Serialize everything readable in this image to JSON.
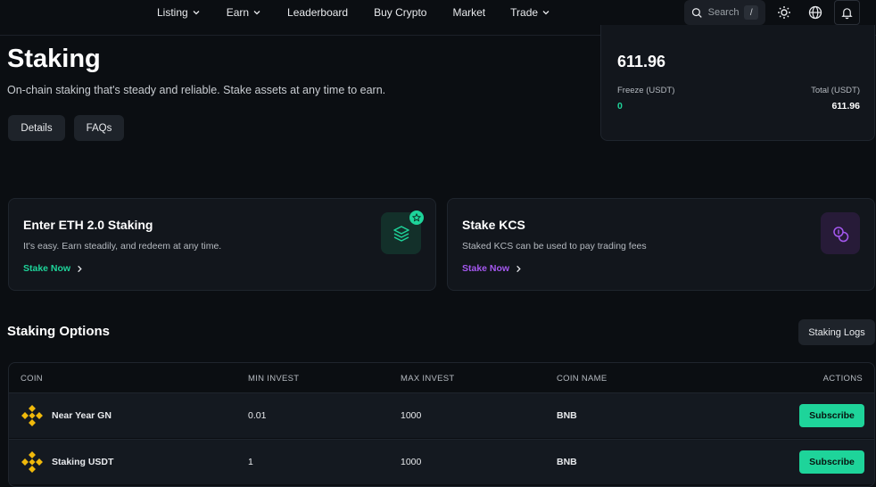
{
  "nav": {
    "items": [
      {
        "label": "Listing",
        "dropdown": true
      },
      {
        "label": "Earn",
        "dropdown": true
      },
      {
        "label": "Leaderboard",
        "dropdown": false
      },
      {
        "label": "Buy Crypto",
        "dropdown": false
      },
      {
        "label": "Market",
        "dropdown": false
      },
      {
        "label": "Trade",
        "dropdown": true
      }
    ],
    "search_label": "Search",
    "search_shortcut": "/"
  },
  "hero": {
    "title": "Staking",
    "subtitle": "On-chain staking that's steady and reliable. Stake assets at any time to earn.",
    "details_label": "Details",
    "faqs_label": "FAQs"
  },
  "balance": {
    "amount": "611.96",
    "freeze_label": "Freeze (USDT)",
    "freeze_value": "0",
    "total_label": "Total (USDT)",
    "total_value": "611.96"
  },
  "promos": [
    {
      "title": "Enter ETH 2.0 Staking",
      "desc": "It's easy. Earn steadily, and redeem at any time.",
      "link": "Stake Now",
      "accent": "#1ed49a"
    },
    {
      "title": "Stake KCS",
      "desc": "Staked KCS can be used to pay trading fees",
      "link": "Stake Now",
      "accent": "#a558f0"
    }
  ],
  "options": {
    "title": "Staking Options",
    "logs_label": "Staking Logs",
    "columns": [
      "COIN",
      "MIN INVEST",
      "MAX INVEST",
      "COIN NAME",
      "ACTIONS"
    ],
    "rows": [
      {
        "coin": "Near Year GN",
        "min": "0.01",
        "max": "1000",
        "name": "BNB",
        "action": "Subscribe"
      },
      {
        "coin": "Staking USDT",
        "min": "1",
        "max": "1000",
        "name": "BNB",
        "action": "Subscribe"
      }
    ]
  },
  "colors": {
    "accent_green": "#1ed49a",
    "accent_purple": "#a558f0",
    "bnb_yellow": "#f0b90b"
  }
}
